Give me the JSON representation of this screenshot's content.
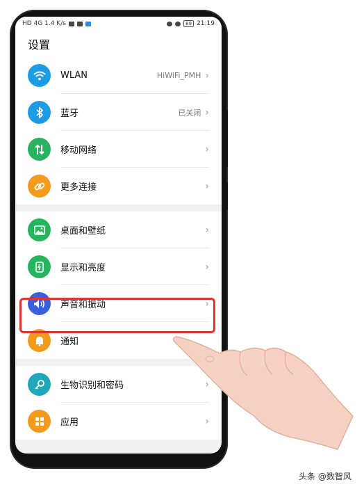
{
  "status_bar": {
    "left_text": "HD 4G 1.4 K/s",
    "time": "21:19",
    "battery": "89"
  },
  "page": {
    "title": "设置"
  },
  "settings": {
    "items": [
      {
        "label": "WLAN",
        "value": "HiWiFi_PMH",
        "icon": "wifi-icon",
        "color": "#1d9ce6"
      },
      {
        "label": "蓝牙",
        "value": "已关闭",
        "icon": "bluetooth-icon",
        "color": "#1d9ce6"
      },
      {
        "label": "移动网络",
        "value": "",
        "icon": "mobile-data-icon",
        "color": "#27b45f"
      },
      {
        "label": "更多连接",
        "value": "",
        "icon": "link-icon",
        "color": "#f49a1c"
      },
      {
        "label": "桌面和壁纸",
        "value": "",
        "icon": "wallpaper-icon",
        "color": "#27b45f"
      },
      {
        "label": "显示和亮度",
        "value": "",
        "icon": "display-icon",
        "color": "#27b45f"
      },
      {
        "label": "声音和振动",
        "value": "",
        "icon": "speaker-icon",
        "color": "#3a5fdc"
      },
      {
        "label": "通知",
        "value": "",
        "icon": "bell-icon",
        "color": "#f49a1c"
      },
      {
        "label": "生物识别和密码",
        "value": "",
        "icon": "key-icon",
        "color": "#1fa8b8"
      },
      {
        "label": "应用",
        "value": "",
        "icon": "apps-icon",
        "color": "#f49a1c"
      }
    ]
  },
  "watermark": "头条 @数智风"
}
